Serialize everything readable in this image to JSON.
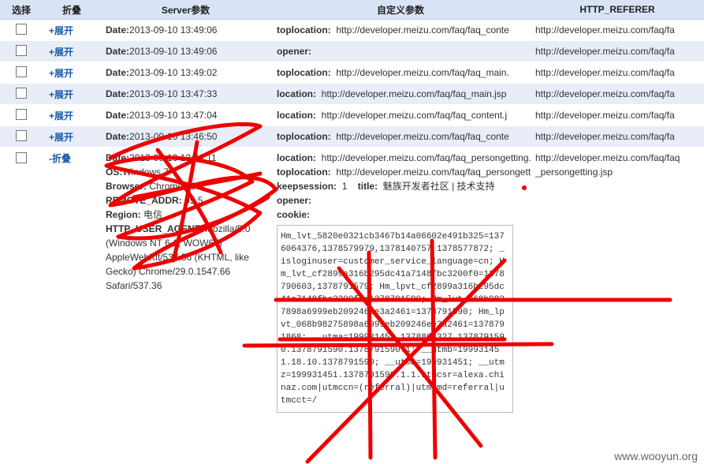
{
  "headers": {
    "select": "选择",
    "fold": "折叠",
    "server": "Server参数",
    "custom": "自定义参数",
    "referer": "HTTP_REFERER"
  },
  "rows": [
    {
      "toggle": "+展开",
      "date_label": "Date:",
      "date": "2013-09-10 13:49:06",
      "custom_key": "toplocation:",
      "custom_val": "http://developer.meizu.com/faq/faq_conte",
      "referer": "http://developer.meizu.com/faq/fa"
    },
    {
      "toggle": "+展开",
      "date_label": "Date:",
      "date": "2013-09-10 13:49:06",
      "custom_key": "opener:",
      "custom_val": "",
      "referer": "http://developer.meizu.com/faq/fa"
    },
    {
      "toggle": "+展开",
      "date_label": "Date:",
      "date": "2013-09-10 13:49:02",
      "custom_key": "toplocation:",
      "custom_val": "http://developer.meizu.com/faq/faq_main.",
      "referer": "http://developer.meizu.com/faq/fa"
    },
    {
      "toggle": "+展开",
      "date_label": "Date:",
      "date": "2013-09-10 13:47:33",
      "custom_key": "location:",
      "custom_val": "http://developer.meizu.com/faq/faq_main.jsp",
      "referer": "http://developer.meizu.com/faq/fa"
    },
    {
      "toggle": "+展开",
      "date_label": "Date:",
      "date": "2013-09-10 13:47:04",
      "custom_key": "location:",
      "custom_val": "http://developer.meizu.com/faq/faq_content.j",
      "referer": "http://developer.meizu.com/faq/fa"
    },
    {
      "toggle": "+展开",
      "date_label": "Date:",
      "date": "2013-09-10 13:46:50",
      "custom_key": "toplocation:",
      "custom_val": "http://developer.meizu.com/faq/faq_conte",
      "referer": "http://developer.meizu.com/faq/fa"
    }
  ],
  "expanded": {
    "toggle": "-折叠",
    "server": {
      "date_label": "Date:",
      "date": "2013-09-10 13:46:11",
      "os_label": "OS:",
      "os": "Windows 7",
      "browser_label": "Browser:",
      "browser": "Chrome 29.0",
      "ip_label": "REMOTE_ADDR:",
      "ip": "05.5",
      "region_label": "Region:",
      "region": "电信",
      "ua_label": "HTTP_USER_AGENT:",
      "ua": "Mozilla/5.0 (Windows NT 6.1; WOW64) AppleWebKit/537.36 (KHTML, like Gecko) Chrome/29.0.1547.66 Safari/537.36"
    },
    "custom": {
      "location_label": "location:",
      "location": "http://developer.meizu.com/faq/faq_persongetting.jsp",
      "toplocation_label": "toplocation:",
      "toplocation": "http://developer.meizu.com/faq/faq_persongetting.jsp",
      "keepsession_label": "keepsession:",
      "keepsession": "1",
      "title_label": "title:",
      "title": "魅族开发者社区 | 技术支持",
      "opener_label": "opener:",
      "cookie_label": "cookie:",
      "cookie": "Hm_lvt_5820e0321cb3467b14a06602e491b325=1376064376,1378579979,1378140757,1378577872; _isloginuser=customer_service_language=cn; Hm_lvt_cf2899a316b295dc41a7148fbc3200f0=1378790603,1378791579; Hm_lpvt_cf2899a316b295dc41a7148fbc3200f0=1378791590; Hm_lvt_068b9827898a6999eb209246ee3a2461=1378791590; Hm_lpvt_068b98275898a6999eb209246ee3a2461=1378791868; __utma=199931451.1378868327.1378791590.1378791590.1378791590.1; __utmb=199931451.18.10.1378791590; __utmc=199931451; __utmz=199931451.1378791590.1.1.utmcsr=alexa.chinaz.com|utmccn=(referral)|utmcmd=referral|utmcct=/"
    },
    "referer": "http://developer.meizu.com/faq/faq_persongetting.jsp"
  },
  "watermark": "www.wooyun.org",
  "colors": {
    "header_bg": "#d9e3f6",
    "alt_row": "#e8edf8",
    "toggle": "#1a5aa8",
    "scribble": "#ee0000"
  }
}
